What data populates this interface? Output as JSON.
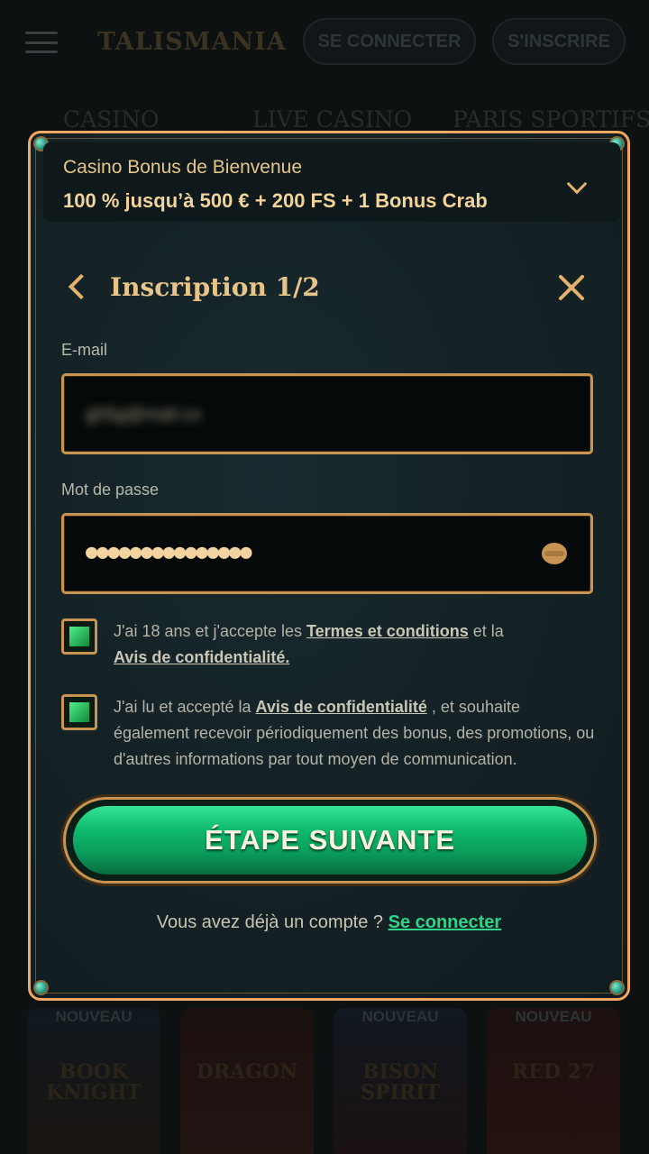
{
  "background": {
    "logo": "TALISMANIA",
    "login_label": "SE CONNECTER",
    "signup_label": "S'INSCRIRE",
    "nav": [
      "CASINO",
      "LIVE CASINO",
      "PARIS SPORTIFS"
    ],
    "games": [
      {
        "tag": "NOUVEAU",
        "title": "BOOK KNIGHT"
      },
      {
        "tag": "",
        "title": "DRAGON"
      },
      {
        "tag": "NOUVEAU",
        "title": "BISON SPIRIT"
      },
      {
        "tag": "NOUVEAU",
        "title": "RED 27"
      }
    ]
  },
  "bonus": {
    "title": "Casino Bonus de Bienvenue",
    "offer": "100 % jusqu’à 500 € + 200 FS + 1 Bonus Crab"
  },
  "form": {
    "title": "Inscription 1/2",
    "email_label": "E-mail",
    "email_value": "gh5g@mail.co",
    "password_label": "Mot de passe",
    "password_value": "●●●●●●●●●●●●●●●",
    "consent1": {
      "pre": "J'ai 18 ans et j'accepte les ",
      "link1": "Termes et conditions",
      "mid": " et la",
      "link2": "Avis de confidentialité.",
      "checked": true
    },
    "consent2": {
      "pre": "J'ai lu et accepté la ",
      "link": "Avis de confidentialité",
      "post": " , et souhaite également recevoir périodiquement des bonus, des promotions, ou d'autres informations par tout moyen de communication.",
      "checked": true
    },
    "submit_label": "ÉTAPE SUIVANTE",
    "footer_text": "Vous avez déjà un compte ? ",
    "footer_link": "Se connecter"
  },
  "colors": {
    "accent_gold": "#e2b26c",
    "cta_green": "#0fba6e",
    "link_green": "#2fd38a"
  }
}
